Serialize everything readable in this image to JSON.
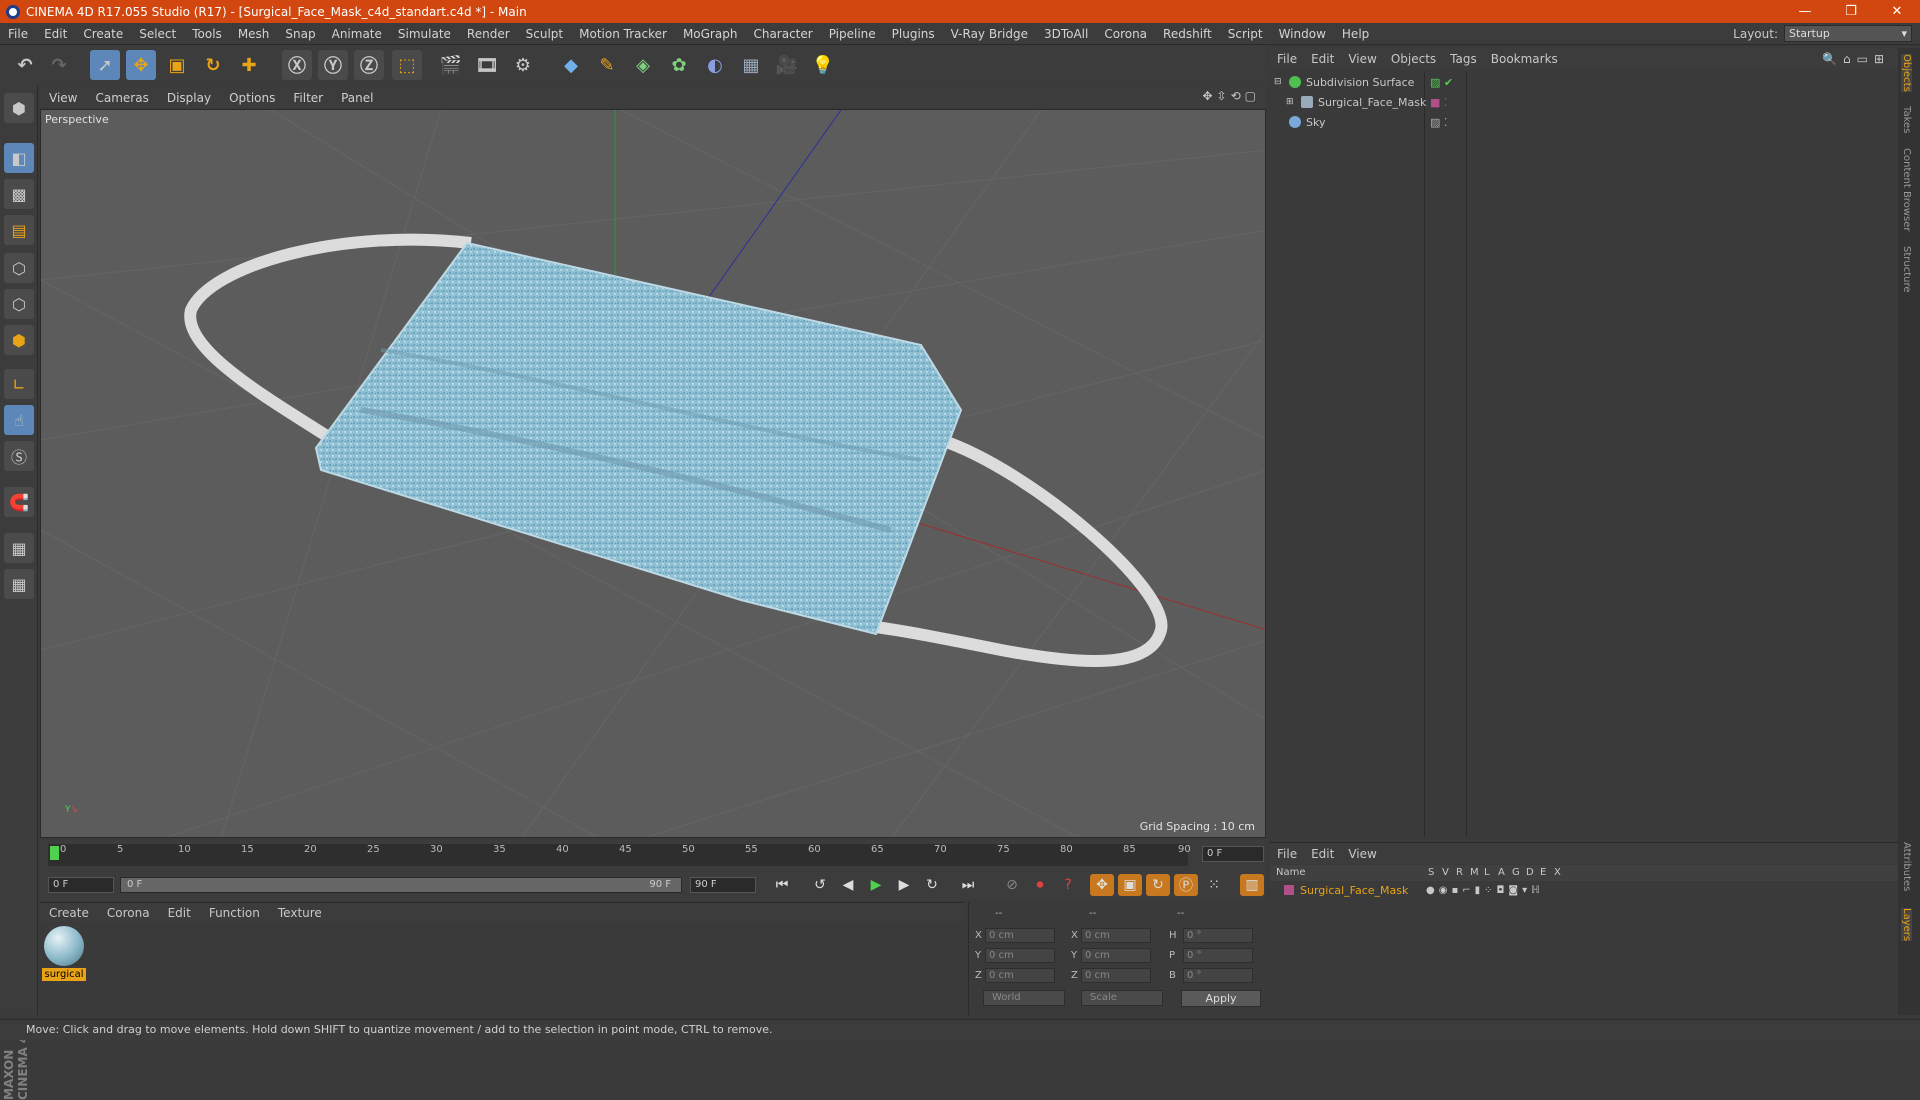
{
  "title": "CINEMA 4D R17.055 Studio (R17) - [Surgical_Face_Mask_c4d_standart.c4d *] - Main",
  "menubar": [
    "File",
    "Edit",
    "Create",
    "Select",
    "Tools",
    "Mesh",
    "Snap",
    "Animate",
    "Simulate",
    "Render",
    "Sculpt",
    "Motion Tracker",
    "MoGraph",
    "Character",
    "Pipeline",
    "Plugins",
    "V-Ray Bridge",
    "3DToAll",
    "Corona",
    "Redshift",
    "Script",
    "Window",
    "Help"
  ],
  "layout": {
    "label": "Layout:",
    "value": "Startup"
  },
  "viewport": {
    "menu": [
      "View",
      "Cameras",
      "Display",
      "Options",
      "Filter",
      "Panel"
    ],
    "label": "Perspective",
    "grid_spacing": "Grid Spacing : 10 cm"
  },
  "timeline": {
    "ticks": [
      "0",
      "5",
      "10",
      "15",
      "20",
      "25",
      "30",
      "35",
      "40",
      "45",
      "50",
      "55",
      "60",
      "65",
      "70",
      "75",
      "80",
      "85",
      "90"
    ],
    "current_frame": "0 F",
    "start": "0 F",
    "range_start": "0 F",
    "range_end": "90 F",
    "end": "90 F"
  },
  "material_manager": {
    "menu": [
      "Create",
      "Corona",
      "Edit",
      "Function",
      "Texture"
    ],
    "material_name": "surgical"
  },
  "coordinates": {
    "headers": [
      "--",
      "--",
      "--"
    ],
    "rows": [
      {
        "a": "X",
        "av": "0 cm",
        "b": "X",
        "bv": "0 cm",
        "c": "H",
        "cv": "0 °"
      },
      {
        "a": "Y",
        "av": "0 cm",
        "b": "Y",
        "bv": "0 cm",
        "c": "P",
        "cv": "0 °"
      },
      {
        "a": "Z",
        "av": "0 cm",
        "b": "Z",
        "bv": "0 cm",
        "c": "B",
        "cv": "0 °"
      }
    ],
    "space": "World",
    "mode": "Scale",
    "apply": "Apply"
  },
  "object_manager": {
    "menu": [
      "File",
      "Edit",
      "View",
      "Objects",
      "Tags",
      "Bookmarks"
    ],
    "objects": [
      "Subdivision Surface",
      "Surgical_Face_Mask",
      "Sky"
    ]
  },
  "layer_manager": {
    "menu": [
      "File",
      "Edit",
      "View"
    ],
    "columns": [
      "Name",
      "S",
      "V",
      "R",
      "M",
      "L",
      "A",
      "G",
      "D",
      "E",
      "X"
    ],
    "layer_name": "Surgical_Face_Mask"
  },
  "side_tabs": [
    "Objects",
    "Takes",
    "Content Browser",
    "Structure",
    "Attributes",
    "Layers"
  ],
  "maxon_logo": "MAXON CINEMA 4D",
  "status": "Move: Click and drag to move elements. Hold down SHIFT to quantize movement / add to the selection in point mode, CTRL to remove.",
  "colors": {
    "titlebar": "#d2460f",
    "accent": "#5c87b8",
    "material": "#e8a316"
  }
}
